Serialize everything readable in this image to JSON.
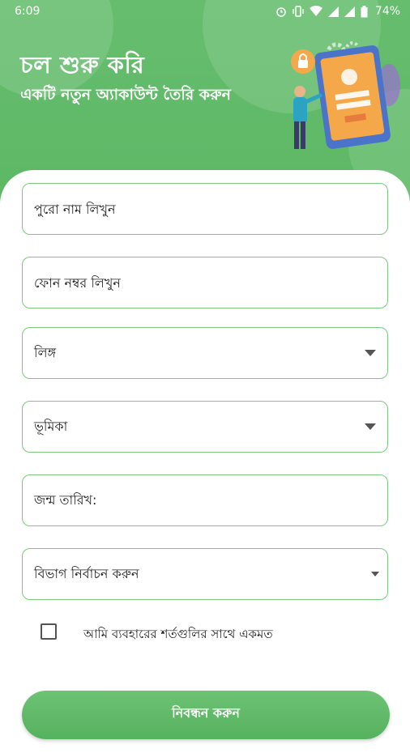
{
  "status_bar": {
    "time": "6:09",
    "battery": "74%",
    "icons": [
      "alarm-icon",
      "vibrate-icon",
      "wifi-icon",
      "signal-icon",
      "signal-icon",
      "battery-icon"
    ]
  },
  "header": {
    "title": "চল শুরু করি",
    "subtitle": "একটি নতুন অ্যাকাউন্ট তৈরি করুন",
    "illustration": "phone-login-illustration"
  },
  "form": {
    "full_name_placeholder": "পুরো নাম লিখুন",
    "phone_placeholder": "ফোন নম্বর লিখুন",
    "gender_label": "লিঙ্গ",
    "role_label": "ভূমিকা",
    "dob_label": "জন্ম তারিখ:",
    "department_label": "বিভাগ নির্বাচন করুন",
    "terms_label": "আমি ব্যবহারের শর্তগুলির সাথে একমত",
    "terms_checked": false,
    "submit_label": "নিবন্ধন করুন"
  },
  "colors": {
    "primary_green": "#5db865",
    "field_border": "#7cc97f"
  }
}
